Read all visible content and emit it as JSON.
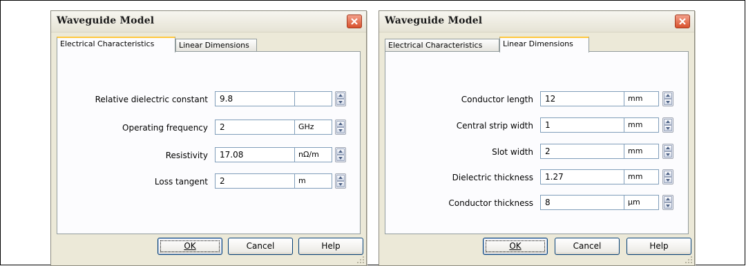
{
  "left_dialog": {
    "title": "Waveguide Model",
    "tabs": [
      {
        "label": "Electrical Characteristics",
        "active": true
      },
      {
        "label": "Linear Dimensions",
        "active": false
      }
    ],
    "fields": [
      {
        "label": "Relative dielectric constant",
        "value": "9.8",
        "unit": ""
      },
      {
        "label": "Operating frequency",
        "value": "2",
        "unit": "GHz"
      },
      {
        "label": "Resistivity",
        "value": "17.08",
        "unit": "nΩ/m"
      },
      {
        "label": "Loss tangent",
        "value": "2",
        "unit": "m"
      }
    ],
    "buttons": {
      "ok": "OK",
      "cancel": "Cancel",
      "help": "Help"
    }
  },
  "right_dialog": {
    "title": "Waveguide Model",
    "tabs": [
      {
        "label": "Electrical Characteristics",
        "active": false
      },
      {
        "label": "Linear Dimensions",
        "active": true
      }
    ],
    "fields": [
      {
        "label": "Conductor length",
        "value": "12",
        "unit": "mm"
      },
      {
        "label": "Central strip width",
        "value": "1",
        "unit": "mm"
      },
      {
        "label": "Slot width",
        "value": "2",
        "unit": "mm"
      },
      {
        "label": "Dielectric thickness",
        "value": "1.27",
        "unit": "mm"
      },
      {
        "label": "Conductor thickness",
        "value": "8",
        "unit": "µm"
      }
    ],
    "buttons": {
      "ok": "OK",
      "cancel": "Cancel",
      "help": "Help"
    }
  },
  "colors": {
    "dialog_bg": "#ece9d8",
    "active_tab_highlight": "#ffc73c",
    "close_button": "#d8512d",
    "input_border": "#7f9db9"
  },
  "icons": {
    "close": "close-icon",
    "spinner": "spinner-icon",
    "resize_grip": "resize-grip-icon"
  }
}
